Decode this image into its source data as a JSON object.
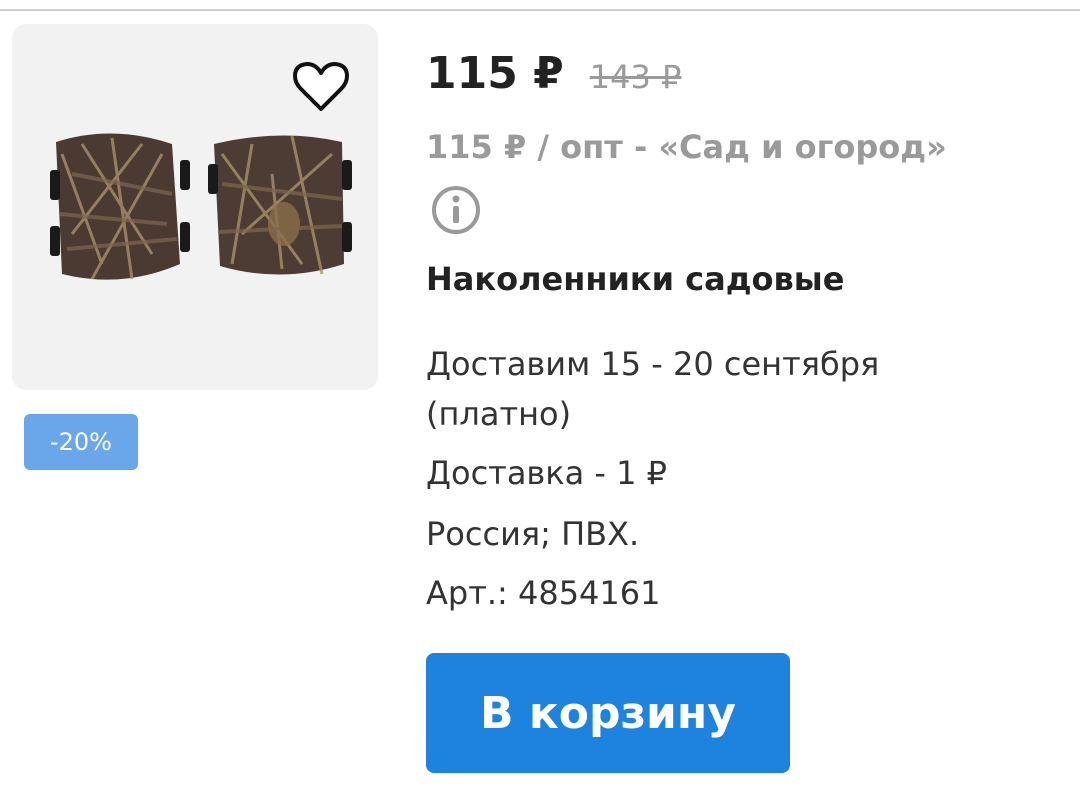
{
  "product": {
    "price_current": "115 ₽",
    "price_old": "143 ₽",
    "wholesale_text": "115 ₽ / опт - «Сад и огород»",
    "name": "Наколенники садовые",
    "delivery_line1": "Доставим 15 - 20 сентября",
    "delivery_line2": "(платно)",
    "delivery_cost": "Доставка - 1 ₽",
    "origin_material": "Россия; ПВХ.",
    "article": "Арт.: 4854161",
    "discount_badge": "-20%",
    "add_to_cart_label": "В корзину"
  },
  "icons": {
    "favorite": "heart-outline-icon",
    "info": "info-circle-icon"
  },
  "colors": {
    "accent": "#1e82df",
    "badge": "#6aa6ea",
    "muted": "#9a9a9a",
    "text": "#222222"
  }
}
